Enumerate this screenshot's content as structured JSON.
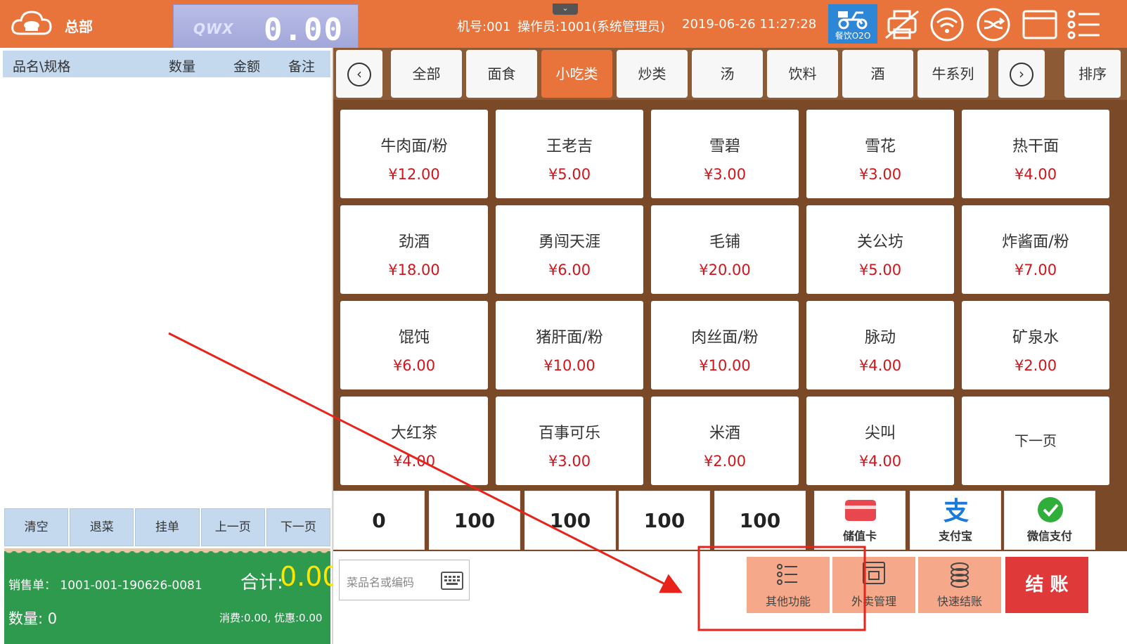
{
  "header": {
    "store_name": "总部",
    "scale_brand": "QWX",
    "scale_value": "0.00",
    "machine": "机号:001",
    "operator": "操作员:1001(系统管理员)",
    "datetime": "2019-06-26 11:27:28",
    "o2o_label": "餐饮O2O"
  },
  "order_table": {
    "columns": [
      "品名\\规格",
      "数量",
      "金额",
      "备注"
    ]
  },
  "side_buttons": [
    "清空",
    "退菜",
    "挂单",
    "上一页",
    "下一页"
  ],
  "summary": {
    "sale_no": "销售单： 1001-001-190626-0081",
    "total_label": "合计:",
    "total_value": "0.00",
    "qty": "数量: 0",
    "consume": "消费:0.00, 优惠:0.00"
  },
  "categories": [
    "全部",
    "面食",
    "小吃类",
    "炒类",
    "汤",
    "饮料",
    "酒",
    "牛系列"
  ],
  "active_category": "小吃类",
  "sort_label": "排序",
  "dishes": [
    {
      "name": "牛肉面/粉",
      "price": "¥12.00"
    },
    {
      "name": "王老吉",
      "price": "¥5.00"
    },
    {
      "name": "雪碧",
      "price": "¥3.00"
    },
    {
      "name": "雪花",
      "price": "¥3.00"
    },
    {
      "name": "热干面",
      "price": "¥4.00"
    },
    {
      "name": "劲酒",
      "price": "¥18.00"
    },
    {
      "name": "勇闯天涯",
      "price": "¥6.00"
    },
    {
      "name": "毛铺",
      "price": "¥20.00"
    },
    {
      "name": "关公坊",
      "price": "¥5.00"
    },
    {
      "name": "炸酱面/粉",
      "price": "¥7.00"
    },
    {
      "name": "馄饨",
      "price": "¥6.00"
    },
    {
      "name": "猪肝面/粉",
      "price": "¥10.00"
    },
    {
      "name": "肉丝面/粉",
      "price": "¥10.00"
    },
    {
      "name": "脉动",
      "price": "¥4.00"
    },
    {
      "name": "矿泉水",
      "price": "¥2.00"
    },
    {
      "name": "大红茶",
      "price": "¥4.00"
    },
    {
      "name": "百事可乐",
      "price": "¥3.00"
    },
    {
      "name": "米酒",
      "price": "¥2.00"
    },
    {
      "name": "尖叫",
      "price": "¥4.00"
    }
  ],
  "dish_next_label": "下一页",
  "quick_amounts": [
    "0",
    "100",
    "100",
    "100",
    "100"
  ],
  "payments": {
    "card": "储值卡",
    "alipay": "支付宝",
    "wechat": "微信支付"
  },
  "search": {
    "placeholder": "菜品名或编码"
  },
  "functions": {
    "other": "其他功能",
    "takeaway": "外卖管理",
    "quick_checkout": "快速结账",
    "checkout": "结 账"
  },
  "colors": {
    "topbar": "#e8743b",
    "active_tab": "#e8743b",
    "price": "#d0151c",
    "summary_bg": "#2e9a4e",
    "checkout": "#e0393a",
    "annotation": "#e8231c"
  }
}
